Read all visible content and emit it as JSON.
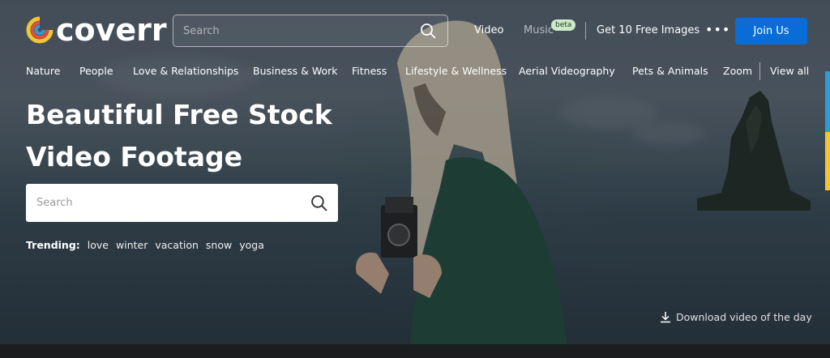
{
  "brand": {
    "name": "coverr"
  },
  "header": {
    "search_placeholder": "Search",
    "nav": {
      "video": "Video",
      "music": "Music",
      "music_badge": "beta",
      "free_images": "Get 10 Free Images",
      "more": "•••",
      "join": "Join Us"
    }
  },
  "categories": [
    "Nature",
    "People",
    "Love & Relationships",
    "Business & Work",
    "Fitness",
    "Lifestyle & Wellness",
    "Aerial Videography",
    "Pets & Animals",
    "Zoom"
  ],
  "categories_view_all": "View all",
  "hero": {
    "headline_line1": "Beautiful Free Stock",
    "headline_line2": "Video Footage",
    "search_placeholder": "Search",
    "trending_label": "Trending:",
    "trending_tags": [
      "love",
      "winter",
      "vacation",
      "snow",
      "yoga"
    ],
    "download_label": "Download video of the day"
  },
  "colors": {
    "accent": "#0a6dd7",
    "badge_bg": "#cde9c8",
    "side_blue": "#2c9bd6",
    "side_yellow": "#f3c534"
  },
  "icons": {
    "search": "search-icon",
    "download": "download-icon",
    "more": "more-dots-icon"
  }
}
